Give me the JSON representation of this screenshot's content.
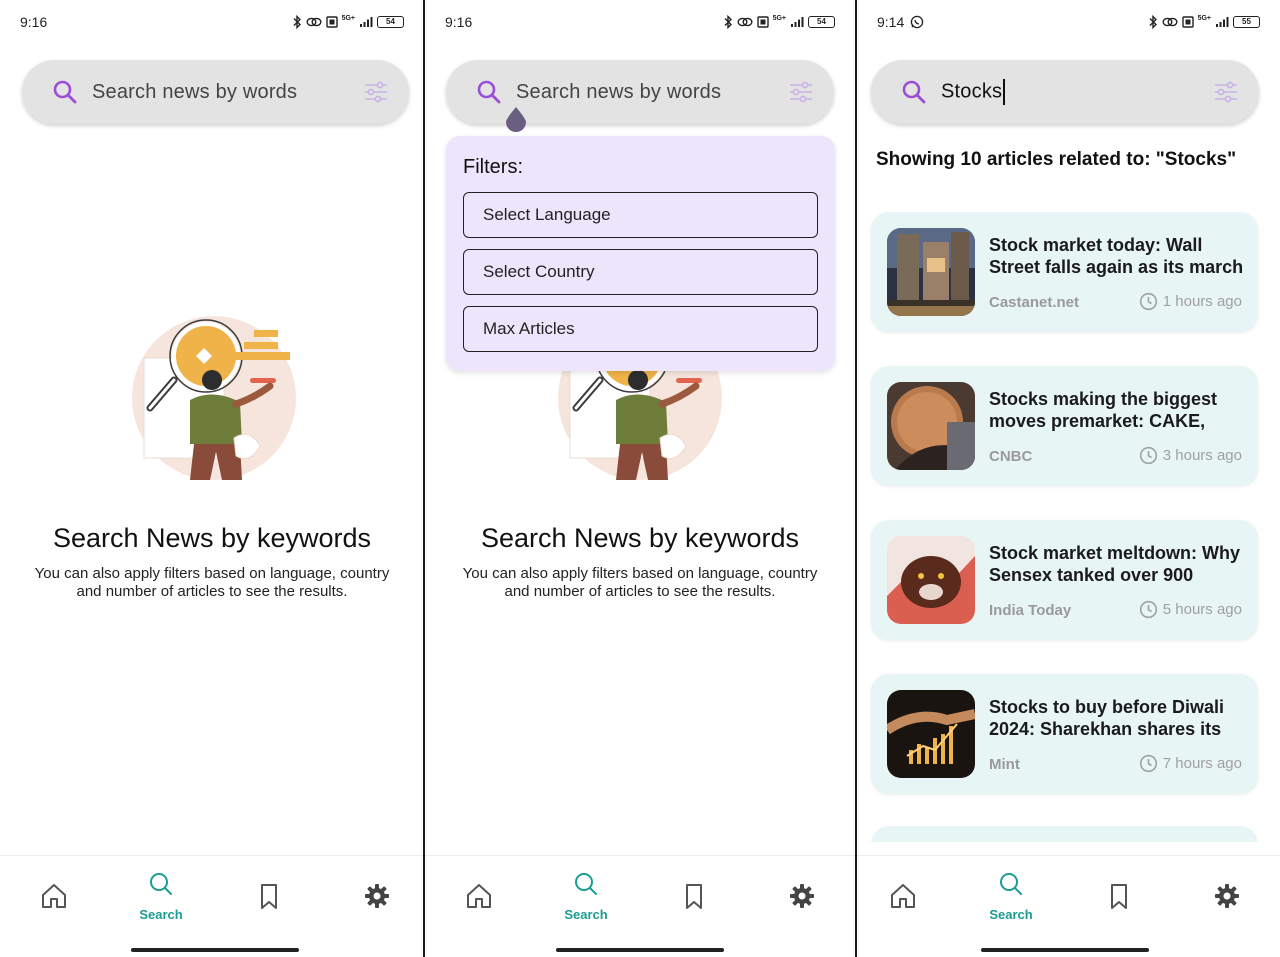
{
  "colors": {
    "accent": "#9b4fd6",
    "nav_active": "#1d9c93",
    "filter_panel": "#ece5fb",
    "card_bg": "#e7f5f4",
    "search_bg": "#e3e3e3"
  },
  "screens": [
    {
      "status": {
        "time": "9:16",
        "battery": "54",
        "network": "5G+"
      },
      "search": {
        "placeholder": "Search news by words",
        "icon": "search-icon",
        "filter_icon": "sliders-icon"
      },
      "empty": {
        "title": "Search News by keywords",
        "subtitle": "You can also apply filters based on language, country and number of articles to see the results."
      },
      "nav": {
        "active_label": "Search"
      }
    },
    {
      "status": {
        "time": "9:16",
        "battery": "54",
        "network": "5G+"
      },
      "search": {
        "placeholder": "Search news by words",
        "icon": "search-icon",
        "filter_icon": "sliders-icon"
      },
      "filters": {
        "title": "Filters:",
        "options": [
          "Select Language",
          "Select Country",
          "Max Articles"
        ]
      },
      "empty": {
        "title": "Search News by keywords",
        "subtitle": "You can also apply filters based on language, country and number of articles to see the results."
      },
      "nav": {
        "active_label": "Search"
      }
    },
    {
      "status": {
        "time": "9:14",
        "battery": "55",
        "network": "5G+",
        "extra_icon": "whatsapp-icon"
      },
      "search": {
        "value": "Stocks",
        "icon": "search-icon",
        "filter_icon": "sliders-icon"
      },
      "results": {
        "heading": "Showing 10 articles related to: \"Stocks\"",
        "articles": [
          {
            "title": "Stock market today: Wall Street falls again as its march",
            "source": "Castanet.net",
            "time": "1 hours ago"
          },
          {
            "title": "Stocks making the biggest moves premarket: CAKE,",
            "source": "CNBC",
            "time": "3 hours ago"
          },
          {
            "title": "Stock market meltdown: Why Sensex tanked over 900",
            "source": "India Today",
            "time": "5 hours ago"
          },
          {
            "title": "Stocks to buy before Diwali 2024: Sharekhan shares its",
            "source": "Mint",
            "time": "7 hours ago"
          }
        ]
      },
      "nav": {
        "active_label": "Search"
      }
    }
  ],
  "nav_items": [
    "home-icon",
    "search-icon",
    "bookmark-icon",
    "settings-icon"
  ]
}
